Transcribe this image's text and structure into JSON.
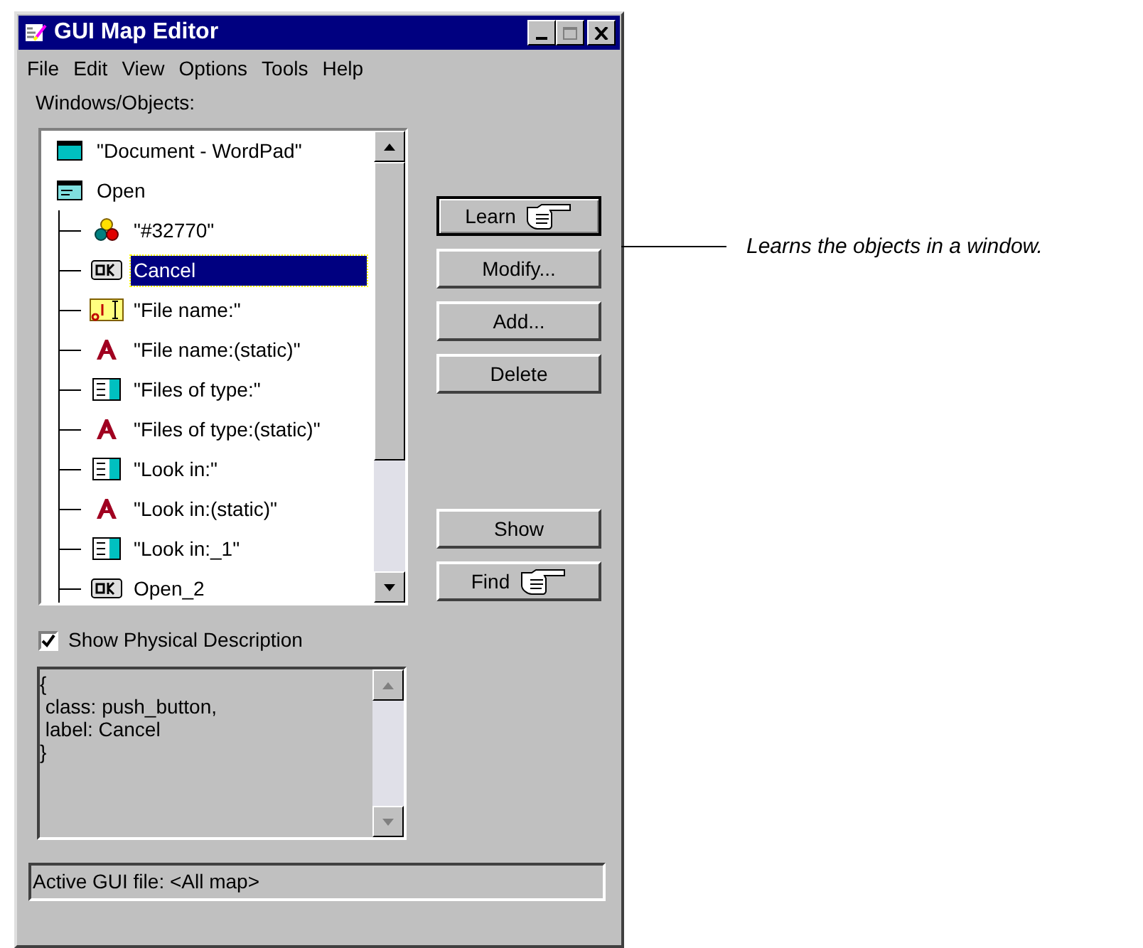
{
  "window": {
    "title": "GUI Map Editor"
  },
  "menu": [
    "File",
    "Edit",
    "View",
    "Options",
    "Tools",
    "Help"
  ],
  "tree_label": "Windows/Objects:",
  "tree": [
    {
      "kind": "window",
      "label": "\"Document - WordPad\"",
      "selected": false
    },
    {
      "kind": "dialog",
      "label": "Open",
      "selected": false,
      "children": [
        {
          "kind": "object",
          "label": "\"#32770\"",
          "selected": false
        },
        {
          "kind": "push_button",
          "label": "Cancel",
          "selected": true
        },
        {
          "kind": "edit",
          "label": "\"File name:\"",
          "selected": false
        },
        {
          "kind": "static",
          "label": "\"File name:(static)\"",
          "selected": false
        },
        {
          "kind": "list",
          "label": "\"Files of type:\"",
          "selected": false
        },
        {
          "kind": "static",
          "label": "\"Files of type:(static)\"",
          "selected": false
        },
        {
          "kind": "list",
          "label": "\"Look in:\"",
          "selected": false
        },
        {
          "kind": "static",
          "label": "\"Look in:(static)\"",
          "selected": false
        },
        {
          "kind": "list",
          "label": "\"Look in:_1\"",
          "selected": false
        },
        {
          "kind": "push_button",
          "label": "Open_2",
          "selected": false
        }
      ]
    }
  ],
  "buttons_top": [
    {
      "label": "Learn",
      "hand": true
    },
    {
      "label": "Modify...",
      "hand": false
    },
    {
      "label": "Add...",
      "hand": false
    },
    {
      "label": "Delete",
      "hand": false
    }
  ],
  "buttons_bottom": [
    {
      "label": "Show",
      "hand": false
    },
    {
      "label": "Find",
      "hand": true
    }
  ],
  "show_physical": {
    "label": "Show Physical Description",
    "checked": true
  },
  "description": [
    "{",
    " class: push_button,",
    " label: Cancel",
    "}"
  ],
  "status": "Active GUI file: <All map>",
  "callout": "Learns the objects in a window."
}
